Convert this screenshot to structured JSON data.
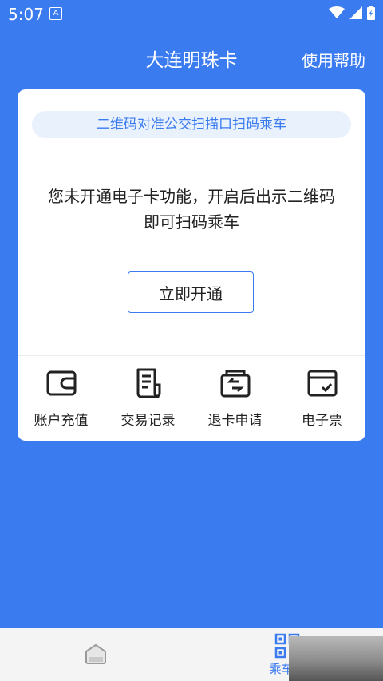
{
  "status_bar": {
    "time": "5:07",
    "notification_icon": "A"
  },
  "header": {
    "title": "大连明珠卡",
    "help": "使用帮助"
  },
  "card": {
    "hint": "二维码对准公交扫描口扫码乘车",
    "notice_line1": "您未开通电子卡功能，开启后出示二维码",
    "notice_line2": "即可扫码乘车",
    "open_button": "立即开通"
  },
  "actions": [
    {
      "label": "账户充值",
      "icon": "wallet-icon"
    },
    {
      "label": "交易记录",
      "icon": "receipt-icon"
    },
    {
      "label": "退卡申请",
      "icon": "card-refund-icon"
    },
    {
      "label": "电子票",
      "icon": "e-ticket-icon"
    }
  ],
  "bottom_nav": {
    "items": [
      {
        "label": "",
        "icon": "home-icon"
      },
      {
        "label": "乘车码",
        "icon": "qr-code-icon",
        "active": true
      }
    ]
  },
  "colors": {
    "accent": "#3a7bf0",
    "pill_bg": "#e9f1fd"
  }
}
